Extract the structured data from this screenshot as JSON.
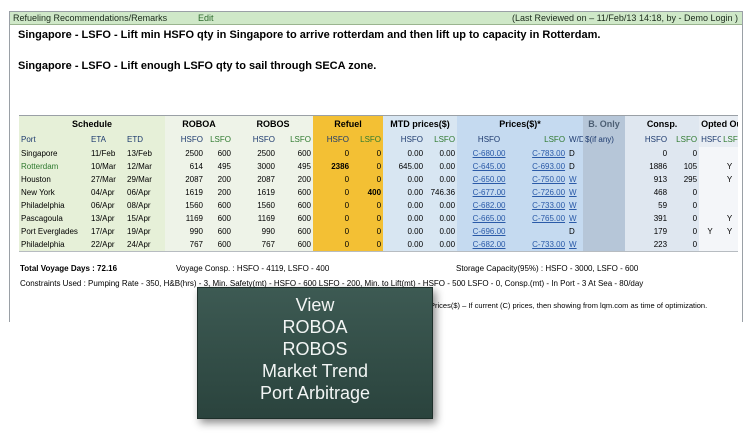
{
  "header": {
    "title": "Refueling Recommendations/Remarks",
    "edit_label": "Edit",
    "review_info": "(Last Reviewed on – 11/Feb/13 14:18, by - Demo Login )"
  },
  "remarks": [
    "Singapore - LSFO - Lift min HSFO qty in Singapore to arrive rotterdam and then lift up to capacity in Rotterdam.",
    "Singapore - LSFO - Lift enough LSFO qty to sail through SECA zone."
  ],
  "table": {
    "groups": {
      "schedule": "Schedule",
      "roboa": "ROBOA",
      "robos": "ROBOS",
      "refuel": "Refuel",
      "mtd": "MTD prices($)",
      "prices": "Prices($)*",
      "bonly": "B. Only",
      "consp": "Consp.",
      "opted": "Opted Out"
    },
    "subheaders": {
      "port": "Port",
      "eta": "ETA",
      "etd": "ETD",
      "hsfo": "HSFO",
      "lsfo": "LSFO",
      "wd": "W/D",
      "bonly_sub": "$(if any)"
    },
    "rows": [
      {
        "port": "Singapore",
        "eta": "11/Feb",
        "etd": "13/Feb",
        "roboa_h": "2500",
        "roboa_l": "600",
        "robos_h": "2500",
        "robos_l": "600",
        "ref_h": "0",
        "ref_l": "0",
        "mtd_h": "0.00",
        "mtd_l": "0.00",
        "pr_h": "C-680.00",
        "pr_l": "C-783.00",
        "wd": "D",
        "bonly": "",
        "c_h": "0",
        "c_l": "0",
        "o_h": "",
        "o_l": ""
      },
      {
        "port": "Rotterdam",
        "eta": "10/Mar",
        "etd": "12/Mar",
        "roboa_h": "614",
        "roboa_l": "495",
        "robos_h": "3000",
        "robos_l": "495",
        "ref_h": "2386",
        "ref_l": "0",
        "mtd_h": "645.00",
        "mtd_l": "0.00",
        "pr_h": "C-645.00",
        "pr_l": "C-693.00",
        "wd": "D",
        "bonly": "",
        "c_h": "1886",
        "c_l": "105",
        "o_h": "",
        "o_l": "Y"
      },
      {
        "port": "Houston",
        "eta": "27/Mar",
        "etd": "29/Mar",
        "roboa_h": "2087",
        "roboa_l": "200",
        "robos_h": "2087",
        "robos_l": "200",
        "ref_h": "0",
        "ref_l": "0",
        "mtd_h": "0.00",
        "mtd_l": "0.00",
        "pr_h": "C-650.00",
        "pr_l": "C-750.00",
        "wd": "W",
        "bonly": "",
        "c_h": "913",
        "c_l": "295",
        "o_h": "",
        "o_l": "Y"
      },
      {
        "port": "New York",
        "eta": "04/Apr",
        "etd": "06/Apr",
        "roboa_h": "1619",
        "roboa_l": "200",
        "robos_h": "1619",
        "robos_l": "600",
        "ref_h": "0",
        "ref_l": "400",
        "mtd_h": "0.00",
        "mtd_l": "746.36",
        "pr_h": "C-677.00",
        "pr_l": "C-726.00",
        "wd": "W",
        "bonly": "",
        "c_h": "468",
        "c_l": "0",
        "o_h": "",
        "o_l": ""
      },
      {
        "port": "Philadelphia",
        "eta": "06/Apr",
        "etd": "08/Apr",
        "roboa_h": "1560",
        "roboa_l": "600",
        "robos_h": "1560",
        "robos_l": "600",
        "ref_h": "0",
        "ref_l": "0",
        "mtd_h": "0.00",
        "mtd_l": "0.00",
        "pr_h": "C-682.00",
        "pr_l": "C-733.00",
        "wd": "W",
        "bonly": "",
        "c_h": "59",
        "c_l": "0",
        "o_h": "",
        "o_l": ""
      },
      {
        "port": "Pascagoula",
        "eta": "13/Apr",
        "etd": "15/Apr",
        "roboa_h": "1169",
        "roboa_l": "600",
        "robos_h": "1169",
        "robos_l": "600",
        "ref_h": "0",
        "ref_l": "0",
        "mtd_h": "0.00",
        "mtd_l": "0.00",
        "pr_h": "C-665.00",
        "pr_l": "C-765.00",
        "wd": "W",
        "bonly": "",
        "c_h": "391",
        "c_l": "0",
        "o_h": "",
        "o_l": "Y"
      },
      {
        "port": "Port Everglades",
        "eta": "17/Apr",
        "etd": "19/Apr",
        "roboa_h": "990",
        "roboa_l": "600",
        "robos_h": "990",
        "robos_l": "600",
        "ref_h": "0",
        "ref_l": "0",
        "mtd_h": "0.00",
        "mtd_l": "0.00",
        "pr_h": "C-696.00",
        "pr_l": "",
        "wd": "D",
        "bonly": "",
        "c_h": "179",
        "c_l": "0",
        "o_h": "Y",
        "o_l": "Y"
      },
      {
        "port": "Philadelphia",
        "eta": "22/Apr",
        "etd": "24/Apr",
        "roboa_h": "767",
        "roboa_l": "600",
        "robos_h": "767",
        "robos_l": "600",
        "ref_h": "0",
        "ref_l": "0",
        "mtd_h": "0.00",
        "mtd_l": "0.00",
        "pr_h": "C-682.00",
        "pr_l": "C-733.00",
        "wd": "W",
        "bonly": "",
        "c_h": "223",
        "c_l": "0",
        "o_h": "",
        "o_l": ""
      }
    ]
  },
  "footer": {
    "voyage_days": "Total Voyage Days : 72.16",
    "voyage_consp": "Voyage Consp. : HSFO - 4119, LSFO - 400",
    "storage": "Storage Capacity(95%) : HSFO - 3000, LSFO - 600",
    "constraints": "Constraints Used : Pumping Rate - 350, H&B(hrs) - 3, Min. Safety(mt) - HSFO - 600 LSFO - 200, Min. to Lift(mt) - HSFO - 500 LSFO - 0, Consp.(mt) - In Port - 3 At Sea - 80/day",
    "note": "Prices($) – If current (C) prices, then showing from lqm.com as time of optimization."
  },
  "overlay": {
    "lines": [
      "View",
      "ROBOA",
      "ROBOS",
      "Market Trend",
      "Port Arbitrage"
    ]
  }
}
